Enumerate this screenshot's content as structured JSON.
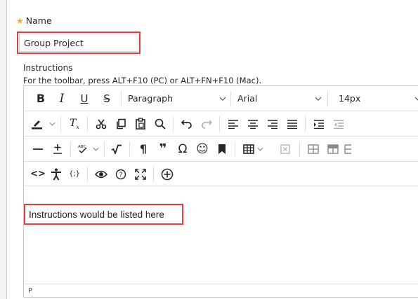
{
  "name_field": {
    "label": "Name",
    "required_marker": "★",
    "value": "Group Project"
  },
  "instructions": {
    "label": "Instructions",
    "hint": "For the toolbar, press ALT+F10 (PC) or ALT+FN+F10 (Mac).",
    "content": "Instructions would be listed here",
    "status_path": "P"
  },
  "toolbar": {
    "bold": "B",
    "italic": "I",
    "underline": "U",
    "strike": "S",
    "format_select": "Paragraph",
    "font_select": "Arial",
    "size_select": "14px",
    "clear_format": "Tx",
    "paragraph_mark": "¶",
    "quote": "❞",
    "omega": "Ω",
    "spellcheck": "ABC",
    "emoji": "☺",
    "code": "<>",
    "math": "{;}",
    "help": "?"
  },
  "colors": {
    "accent_required": "#f5a623",
    "highlight_border": "#e24040"
  }
}
